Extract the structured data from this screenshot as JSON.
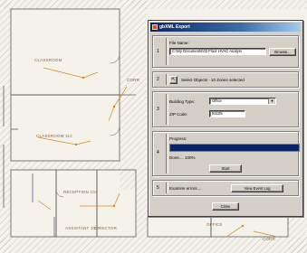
{
  "plan": {
    "room_labels": [
      {
        "text": "CLASSROOM"
      },
      {
        "text": "CLASSROOM 112"
      },
      {
        "text": "RECEPTION 104"
      },
      {
        "text": "ASSISTANT 103"
      },
      {
        "text": "DIRECTOR"
      },
      {
        "text": "CORR"
      },
      {
        "text": "OFFICE"
      },
      {
        "text": "CORR"
      }
    ]
  },
  "dialog": {
    "title": "gbXML Export",
    "app_icon": "app-logo-icon",
    "step1": {
      "num": "1",
      "file_name_label": "File Name:",
      "file_path": "C:\\My Documents\\03 Floor HVAC Analysi",
      "browse_label": "Browse..."
    },
    "step2": {
      "num": "2",
      "select_button_icon": "arrow-select-icon",
      "selection_text": "Select Objects - 10 Zones selected"
    },
    "step3": {
      "num": "3",
      "building_type_label": "Building Type:",
      "building_type_value": "Office",
      "zip_label": "ZIP Code:",
      "zip_value": "94105"
    },
    "step4": {
      "num": "4",
      "progress_label": "Progress:",
      "progress_percent": 100,
      "done_text": "Done.... 100%",
      "start_label": "Start"
    },
    "step5": {
      "num": "5",
      "examine_text": "Examine errors....",
      "view_log_label": "View Event Log"
    },
    "close_label": "Close"
  },
  "colors": {
    "plan_background": "#f4f2ea",
    "title_bar": "#0a246a",
    "progress_fill": "#0a246a",
    "dialog_face": "#d4d0c8"
  }
}
